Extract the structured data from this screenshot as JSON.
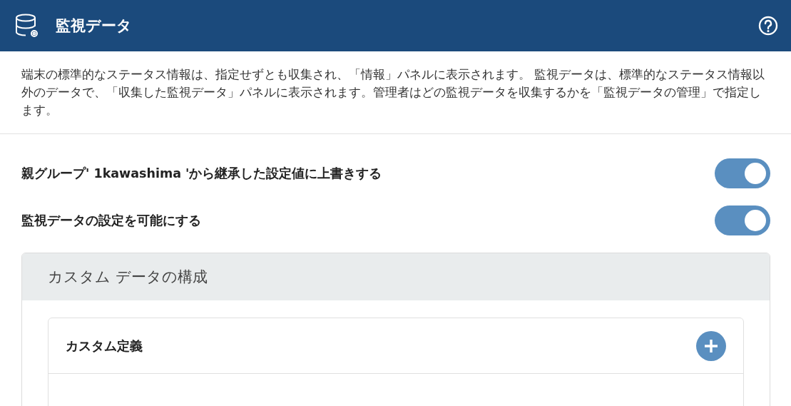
{
  "header": {
    "title": "監視データ"
  },
  "description": "端末の標準的なステータス情報は、指定せずとも収集され、「情報」パネルに表示されます。 監視データは、標準的なステータス情報以外のデータで、「収集した監視データ」パネルに表示されます。管理者はどの監視データを収集するかを「監視データの管理」で指定します。",
  "settings": [
    {
      "label": "親グループ' 1kawashima 'から継承した設定値に上書きする",
      "on": true
    },
    {
      "label": "監視データの設定を可能にする",
      "on": true
    }
  ],
  "custom_panel": {
    "title": "カスタム データの構成",
    "section": {
      "title": "カスタム定義"
    }
  }
}
